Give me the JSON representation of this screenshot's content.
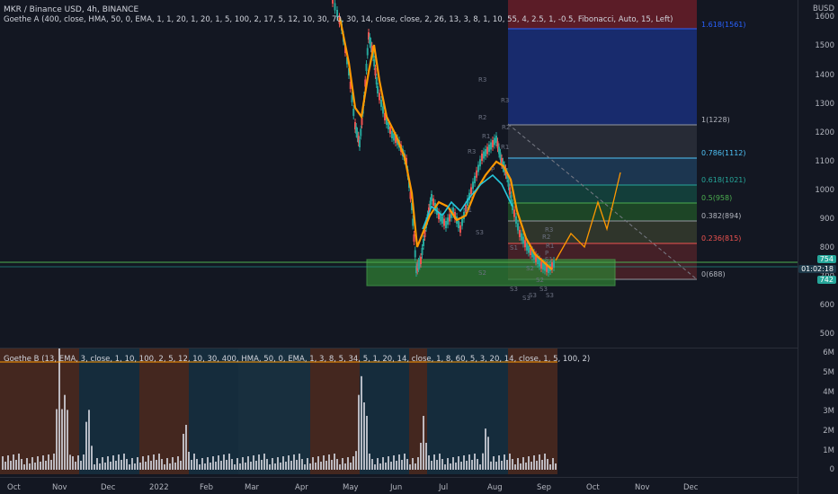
{
  "legend_top": {
    "symbol": "MKR / Binance USD, 4h, BINANCE",
    "indicator": "Goethe A (400, close, HMA, 50, 0, EMA, 1, 1, 20, 1, 20, 1, 5, 100, 2, 17, 5, 12, 10, 30, 70, 30, 14, close, close, 2, 26, 13, 3, 8, 1, 10, 55, 4, 2.5, 1, -0.5, Fibonacci, Auto, 15, Left)"
  },
  "legend_bottom": {
    "indicator": "Goethe B (13, EMA, 3, close, 1, 10, 100, 2, 5, 12, 10, 30, 400, HMA, 50, 0, EMA, 1, 3, 8, 5, 34, 5, 1, 20, 14, close, 1, 8, 60, 5, 3, 20, 14, close, 1, 5, 100, 2)"
  },
  "price_axis": {
    "currency": "BUSD",
    "ticks": [
      "1600",
      "1500",
      "1400",
      "1300",
      "1200",
      "1100",
      "1000",
      "900",
      "800",
      "700",
      "600",
      "500"
    ]
  },
  "volume_axis": {
    "ticks": [
      "6M",
      "5M",
      "4M",
      "3M",
      "2M",
      "1M",
      "0"
    ]
  },
  "time_axis": {
    "ticks": [
      "Oct",
      "Nov",
      "Dec",
      "2022",
      "Feb",
      "Mar",
      "Apr",
      "May",
      "Jun",
      "Jul",
      "Aug",
      "Sep",
      "Oct",
      "Nov",
      "Dec"
    ]
  },
  "fib_levels": [
    {
      "label": "1.618(1561)",
      "color": "#2962ff"
    },
    {
      "label": "1(1228)",
      "color": "#b2b5be"
    },
    {
      "label": "0.786(1112)",
      "color": "#4fc3f7"
    },
    {
      "label": "0.618(1021)",
      "color": "#26a69a"
    },
    {
      "label": "0.5(958)",
      "color": "#4caf50"
    },
    {
      "label": "0.382(894)",
      "color": "#b2b5be"
    },
    {
      "label": "0.236(815)",
      "color": "#ef5350"
    },
    {
      "label": "0(688)",
      "color": "#b2b5be"
    }
  ],
  "pivot_labels": [
    "R3",
    "R3",
    "R2",
    "R2",
    "R3",
    "R1",
    "R1",
    "P",
    "S1",
    "S1",
    "S2",
    "S2",
    "S3",
    "S3",
    "S3",
    "R3",
    "R2",
    "R1",
    "P",
    "S1",
    "S2",
    "S3",
    "S3",
    "S3"
  ],
  "price_badges": [
    {
      "label": "754",
      "color": "#26a69a"
    },
    {
      "label": "01:02:18",
      "color": "#1e3a4a"
    },
    {
      "label": "742",
      "color": "#26a69a"
    }
  ],
  "colors": {
    "up": "#26a69a",
    "down": "#ef5350",
    "ma": "#ff9800",
    "fib_blue": "#2962ff",
    "support_box": "#2e7d32"
  }
}
